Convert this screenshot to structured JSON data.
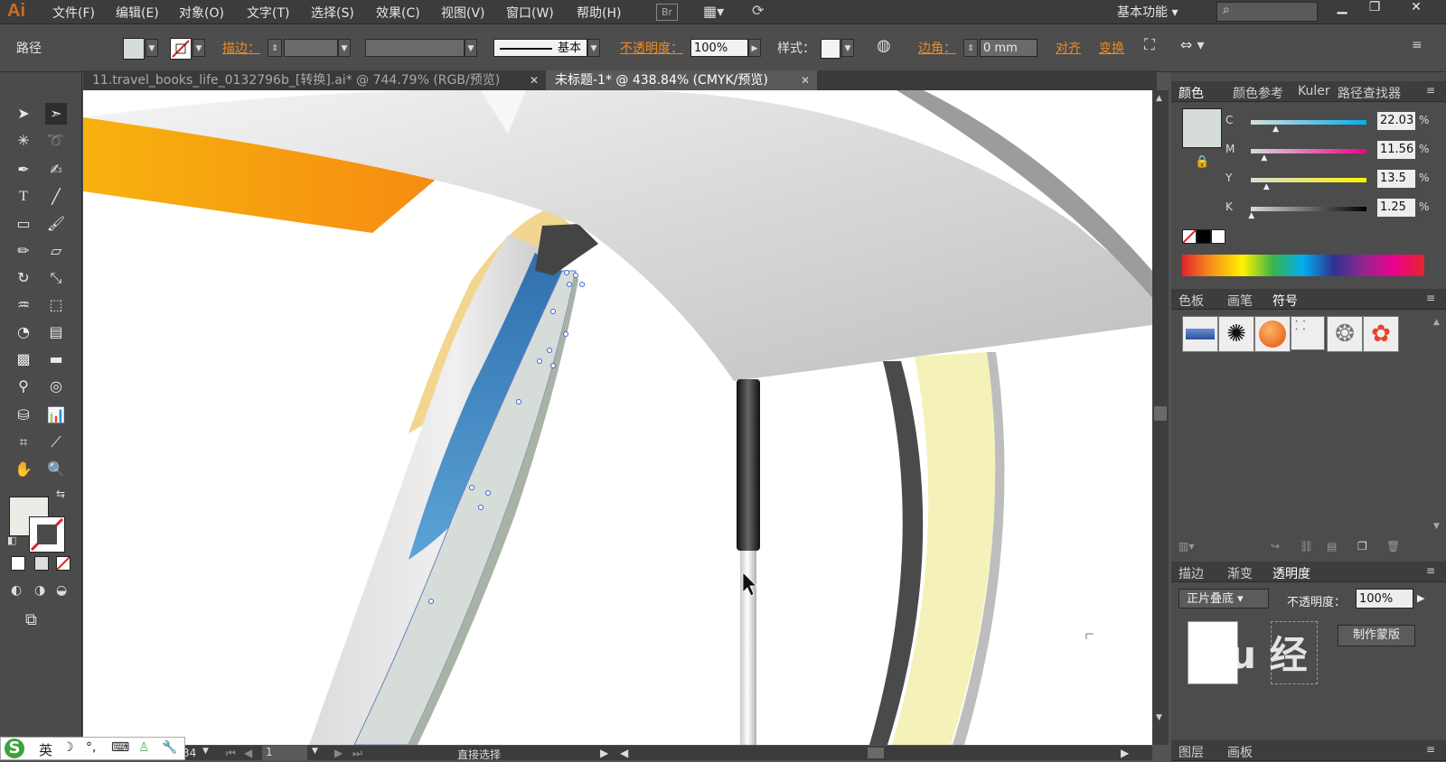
{
  "app": {
    "logo": "Ai"
  },
  "menu": [
    "文件(F)",
    "编辑(E)",
    "对象(O)",
    "文字(T)",
    "选择(S)",
    "效果(C)",
    "视图(V)",
    "窗口(W)",
    "帮助(H)"
  ],
  "menubar": {
    "bridge": "Br",
    "workspace": "基本功能"
  },
  "control": {
    "object_type": "路径",
    "stroke_label": "描边：",
    "stroke_style": "基本",
    "opacity_label": "不透明度：",
    "opacity_value": "100%",
    "style_label": "样式：",
    "corner_label": "边角：",
    "corner_value": "0 mm",
    "align_label": "对齐",
    "transform_label": "变换"
  },
  "tabs": [
    {
      "label": "11.travel_books_life_0132796b_[转换].ai* @ 744.79% (RGB/预览)",
      "active": false
    },
    {
      "label": "未标题-1* @ 438.84% (CMYK/预览)",
      "active": true
    }
  ],
  "color_panel": {
    "tabs": [
      "颜色",
      "颜色参考",
      "Kuler",
      "路径查找器"
    ],
    "swatch_color": "#d6ddd9",
    "channels": [
      {
        "label": "C",
        "value": "22.03",
        "unit": "%",
        "fraction": 0.22
      },
      {
        "label": "M",
        "value": "11.56",
        "unit": "%",
        "fraction": 0.12
      },
      {
        "label": "Y",
        "value": "13.5",
        "unit": "%",
        "fraction": 0.14
      },
      {
        "label": "K",
        "value": "1.25",
        "unit": "%",
        "fraction": 0.01
      }
    ]
  },
  "symbols_panel": {
    "tabs": [
      "色板",
      "画笔",
      "符号"
    ]
  },
  "transparency_panel": {
    "tabs": [
      "描边",
      "渐变",
      "透明度"
    ],
    "blend_mode": "正片叠底",
    "opacity_label": "不透明度：",
    "opacity_value": "100%",
    "make_mask": "制作蒙版"
  },
  "layers_panel": {
    "tabs": [
      "图层",
      "画板"
    ]
  },
  "statusbar": {
    "zoom": "34",
    "page": "1",
    "tool": "直接选择"
  },
  "ime": {
    "lang": "英"
  },
  "watermark": "du 经"
}
